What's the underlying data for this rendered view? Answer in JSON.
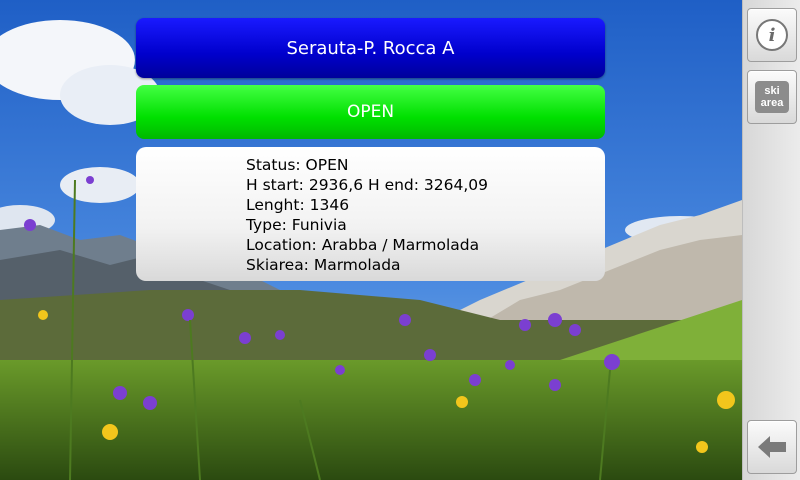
{
  "lift": {
    "name": "Serauta-P. Rocca A",
    "status_label": "OPEN"
  },
  "details": {
    "status": "Status: OPEN",
    "heights": "H start: 2936,6 H end: 3264,09",
    "length": "Lenght: 1346",
    "type": "Type: Funivia",
    "location": "Location: Arabba / Marmolada",
    "skiarea": "Skiarea: Marmolada"
  },
  "sidebar": {
    "info_glyph": "i",
    "ski_line1": "ski",
    "ski_line2": "area",
    "back_icon": "arrow-left-icon"
  },
  "colors": {
    "title_bar": "#0000cc",
    "status_open": "#00e000"
  }
}
